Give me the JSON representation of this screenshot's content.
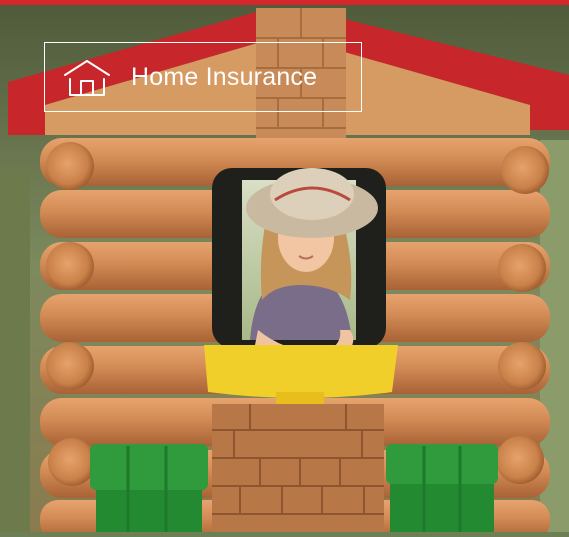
{
  "colors": {
    "accent_stripe": "#d5262b",
    "badge_border": "#ffffff",
    "badge_text": "#ffffff"
  },
  "badge": {
    "icon": "house-outline-icon",
    "label": "Home Insurance"
  },
  "photo": {
    "subject": "child-in-log-playhouse-window"
  }
}
